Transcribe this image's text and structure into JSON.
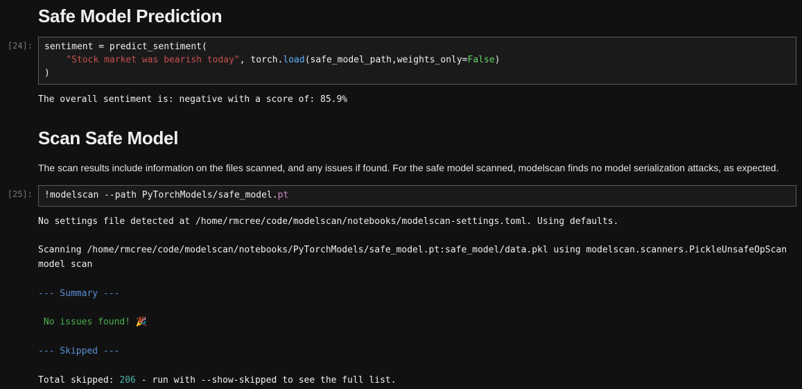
{
  "section1": {
    "title": "Safe Model Prediction"
  },
  "cell24": {
    "prompt": "[24]:",
    "code": {
      "line1_a": "sentiment ",
      "line1_op": "=",
      "line1_b": " predict_sentiment(",
      "line2_indent": "    ",
      "line2_str": "\"Stock market was bearish today\"",
      "line2_mid": ", torch.",
      "line2_func": "load",
      "line2_after": "(safe_model_path,weights_only",
      "line2_eq": "=",
      "line2_kw": "False",
      "line2_close": ")",
      "line3": ")"
    },
    "output": "The overall sentiment is: negative with a score of: 85.9%"
  },
  "section2": {
    "title": "Scan Safe Model",
    "paragraph": "The scan results include information on the files scanned, and any issues if found. For the safe model scanned, modelscan finds no model serialization attacks, as expected."
  },
  "cell25": {
    "prompt": "[25]:",
    "code": {
      "bang": "!",
      "cmd_a": "modelscan ",
      "flag": "--",
      "cmd_b": "path PyTorchModels",
      "slash": "/",
      "cmd_c": "safe_model",
      "dot": ".",
      "ext": "pt"
    },
    "output": {
      "l1": "No settings file detected at /home/rmcree/code/modelscan/notebooks/modelscan-settings.toml. Using defaults.",
      "l2": "",
      "l3": "Scanning /home/rmcree/code/modelscan/notebooks/PyTorchModels/safe_model.pt:safe_model/data.pkl using modelscan.scanners.PickleUnsafeOpScan model scan",
      "l4": "",
      "l5": "--- Summary ---",
      "l6": "",
      "l7": " No issues found! 🎉",
      "l8": "",
      "l9": "--- Skipped ---",
      "l10": "",
      "l11_a": "Total skipped: ",
      "l11_num": "206",
      "l11_b": " - run with --show-skipped to see the full list."
    }
  }
}
